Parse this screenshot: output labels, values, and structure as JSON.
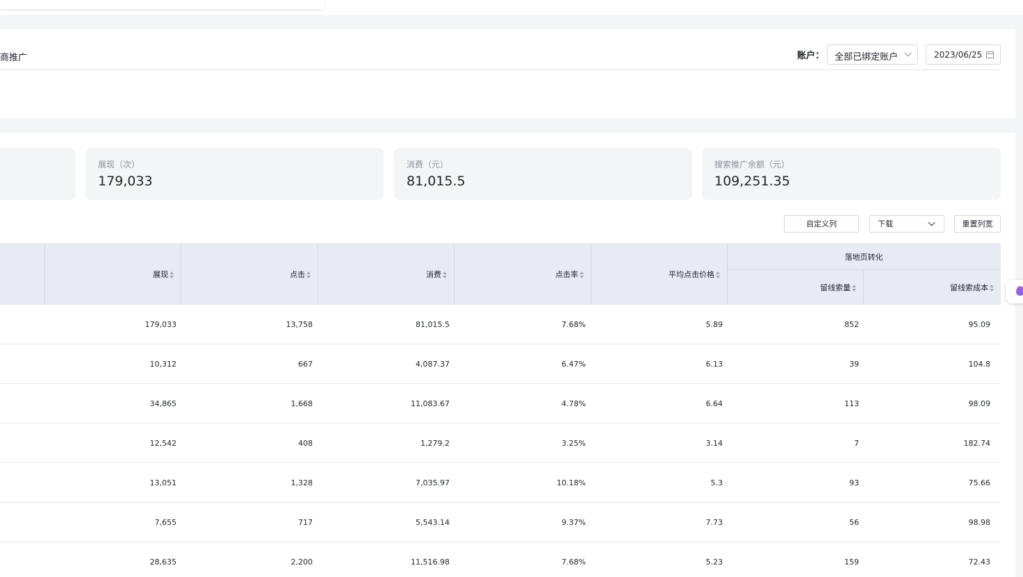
{
  "header": {
    "breadcrumb": "电商推广",
    "account_label": "账户：",
    "account_value": "全部已绑定账户",
    "date": "2023/06/25"
  },
  "cards": [
    {
      "label": "展现（次）",
      "value": "179,033"
    },
    {
      "label": "消费（元）",
      "value": "81,015.5"
    },
    {
      "label": "搜索推广余额（元）",
      "value": "109,251.35"
    }
  ],
  "toolbar": {
    "custom_columns": "自定义列",
    "download": "下载",
    "reset_width": "重置列宽"
  },
  "table": {
    "columns": [
      "展现",
      "点击",
      "消费",
      "点击率",
      "平均点击价格"
    ],
    "group_header": "落地页转化",
    "group_columns": [
      "留线索量",
      "留线索成本"
    ],
    "rows": [
      [
        "179,033",
        "13,758",
        "81,015.5",
        "7.68%",
        "5.89",
        "852",
        "95.09"
      ],
      [
        "10,312",
        "667",
        "4,087.37",
        "6.47%",
        "6.13",
        "39",
        "104.8"
      ],
      [
        "34,865",
        "1,668",
        "11,083.67",
        "4.78%",
        "6.64",
        "113",
        "98.09"
      ],
      [
        "12,542",
        "408",
        "1,279.2",
        "3.25%",
        "3.14",
        "7",
        "182.74"
      ],
      [
        "13,051",
        "1,328",
        "7,035.97",
        "10.18%",
        "5.3",
        "93",
        "75.66"
      ],
      [
        "7,655",
        "717",
        "5,543.14",
        "9.37%",
        "7.73",
        "56",
        "98.98"
      ],
      [
        "28,635",
        "2,200",
        "11,516.98",
        "7.68%",
        "5.23",
        "159",
        "72.43"
      ]
    ]
  },
  "icons": {
    "calendar": "calendar-icon",
    "chevron": "chevron-down-icon",
    "sort": "sort-icon",
    "float": "gem-icon"
  }
}
